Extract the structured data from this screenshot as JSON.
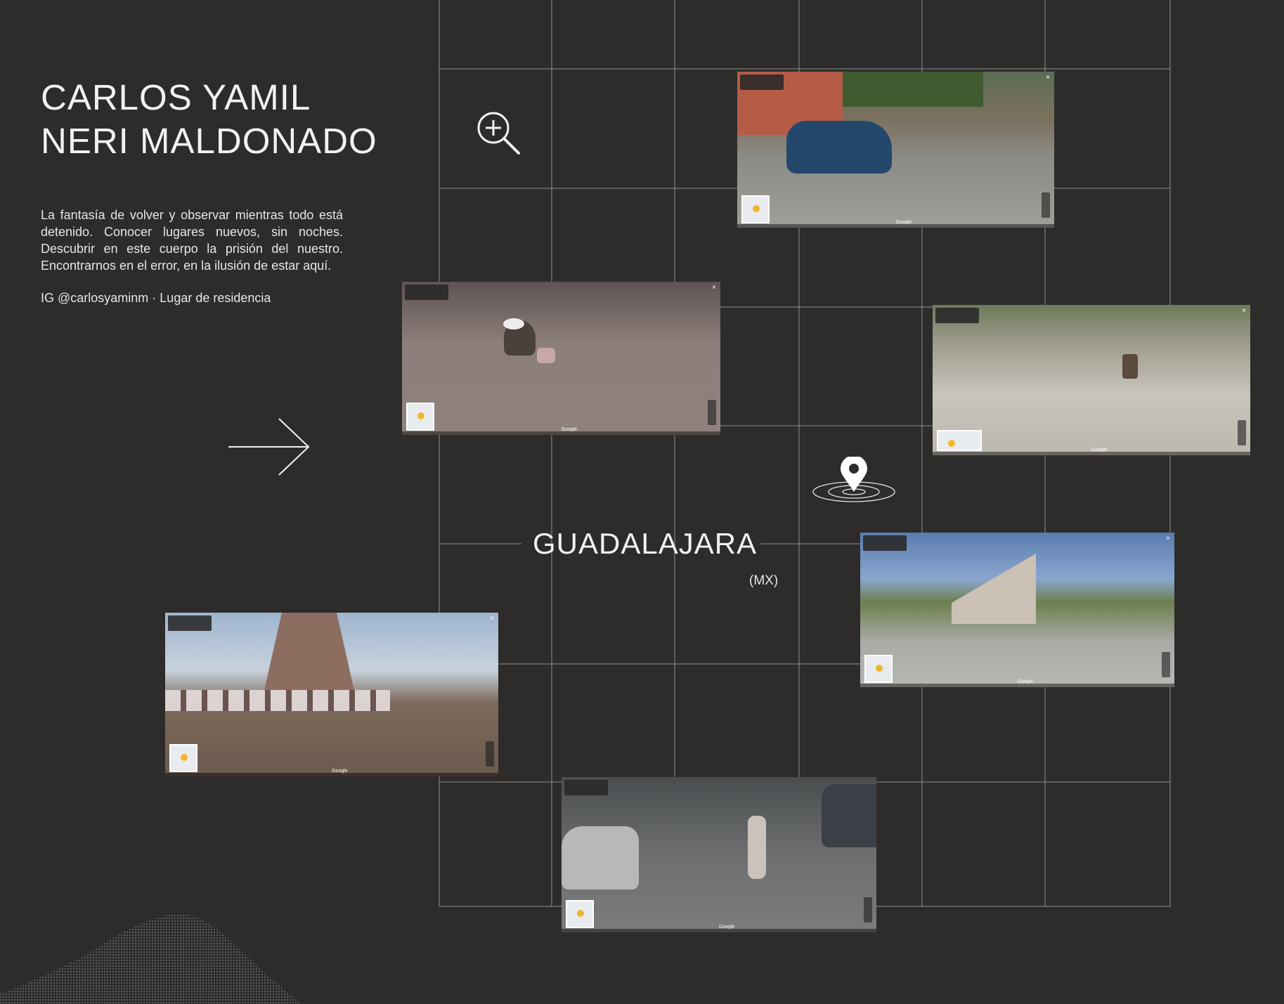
{
  "artist": {
    "name": "CARLOS YAMIL\nNERI MALDONADO",
    "statement": "La fantasía de volver y observar mientras todo está detenido. Conocer lugares nuevos, sin noches. Descubrir en este cuerpo la prisión del nuestro. Encontrarnos en el error, en la ilusión de estar aquí.",
    "credit": "IG @carlosyaminm · Lugar de residencia"
  },
  "location": {
    "city": "GUADALAJARA",
    "country": "(MX)"
  },
  "icons": {
    "zoom": "zoom-in-icon",
    "arrow": "arrow-right-icon",
    "pin": "map-pin-icon"
  },
  "screenshots": {
    "google_label": "Google",
    "close_label": "×",
    "items": [
      {
        "id": "street-car",
        "scene": "street-car"
      },
      {
        "id": "beach-sand",
        "scene": "sand"
      },
      {
        "id": "dirt-road",
        "scene": "dirt"
      },
      {
        "id": "wall-hill",
        "scene": "wall"
      },
      {
        "id": "monument",
        "scene": "monument"
      },
      {
        "id": "cyclist-road",
        "scene": "cyclist"
      }
    ]
  },
  "colors": {
    "background": "#2d2c2b",
    "grid_line": "#9a9a9a",
    "text": "#f2f2f2"
  }
}
